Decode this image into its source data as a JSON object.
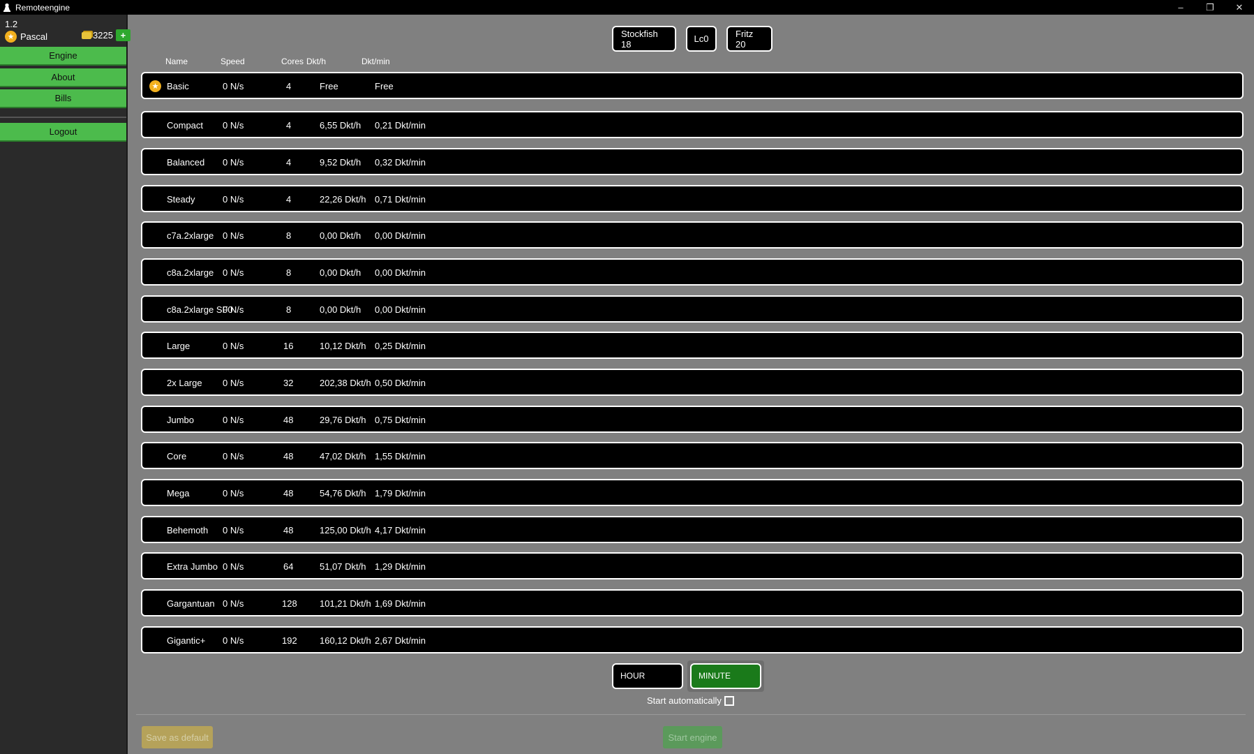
{
  "window": {
    "title": "Remoteengine",
    "controls": [
      "–",
      "❐",
      "✕"
    ]
  },
  "sidebar": {
    "version": "1.2",
    "user": "Pascal",
    "coins": "3225",
    "add_label": "+",
    "nav": [
      {
        "label": "Engine"
      },
      {
        "label": "About"
      },
      {
        "label": "Bills"
      }
    ],
    "logout_label": "Logout"
  },
  "engines": [
    "Stockfish 18",
    "Lc0",
    "Fritz 20"
  ],
  "columns": {
    "name": "Name",
    "speed": "Speed",
    "cores": "Cores",
    "per_hour": "Dkt/h",
    "per_min": "Dkt/min"
  },
  "rows": [
    {
      "name": "Basic",
      "speed": "0 N/s",
      "cores": "4",
      "per_hour": "Free",
      "per_min": "Free",
      "starred": true
    },
    {
      "name": "Compact",
      "speed": "0 N/s",
      "cores": "4",
      "per_hour": "6,55 Dkt/h",
      "per_min": "0,21 Dkt/min"
    },
    {
      "name": "Balanced",
      "speed": "0 N/s",
      "cores": "4",
      "per_hour": "9,52 Dkt/h",
      "per_min": "0,32 Dkt/min"
    },
    {
      "name": "Steady",
      "speed": "0 N/s",
      "cores": "4",
      "per_hour": "22,26 Dkt/h",
      "per_min": "0,71 Dkt/min"
    },
    {
      "name": "c7a.2xlarge",
      "speed": "0 N/s",
      "cores": "8",
      "per_hour": "0,00 Dkt/h",
      "per_min": "0,00 Dkt/min"
    },
    {
      "name": "c8a.2xlarge",
      "speed": "0 N/s",
      "cores": "8",
      "per_hour": "0,00 Dkt/h",
      "per_min": "0,00 Dkt/min"
    },
    {
      "name": "c8a.2xlarge SF0",
      "speed": "0 N/s",
      "cores": "8",
      "per_hour": "0,00 Dkt/h",
      "per_min": "0,00 Dkt/min"
    },
    {
      "name": "Large",
      "speed": "0 N/s",
      "cores": "16",
      "per_hour": "10,12 Dkt/h",
      "per_min": "0,25 Dkt/min"
    },
    {
      "name": "2x Large",
      "speed": "0 N/s",
      "cores": "32",
      "per_hour": "202,38 Dkt/h",
      "per_min": "0,50 Dkt/min"
    },
    {
      "name": "Jumbo",
      "speed": "0 N/s",
      "cores": "48",
      "per_hour": "29,76 Dkt/h",
      "per_min": "0,75 Dkt/min"
    },
    {
      "name": "Core",
      "speed": "0 N/s",
      "cores": "48",
      "per_hour": "47,02 Dkt/h",
      "per_min": "1,55 Dkt/min"
    },
    {
      "name": "Mega",
      "speed": "0 N/s",
      "cores": "48",
      "per_hour": "54,76 Dkt/h",
      "per_min": "1,79 Dkt/min"
    },
    {
      "name": "Behemoth",
      "speed": "0 N/s",
      "cores": "48",
      "per_hour": "125,00 Dkt/h",
      "per_min": "4,17 Dkt/min"
    },
    {
      "name": "Extra Jumbo",
      "speed": "0 N/s",
      "cores": "64",
      "per_hour": "51,07 Dkt/h",
      "per_min": "1,29 Dkt/min"
    },
    {
      "name": "Gargantuan",
      "speed": "0 N/s",
      "cores": "128",
      "per_hour": "101,21 Dkt/h",
      "per_min": "1,69 Dkt/min"
    },
    {
      "name": "Gigantic+",
      "speed": "0 N/s",
      "cores": "192",
      "per_hour": "160,12 Dkt/h",
      "per_min": "2,67 Dkt/min"
    }
  ],
  "units": {
    "hour": "HOUR",
    "minute": "MINUTE",
    "selected": "MINUTE"
  },
  "autostart_label": "Start automatically",
  "save_default_label": "Save as default",
  "start_engine_label": "Start engine",
  "colors": {
    "accent_green": "#4cbb4c",
    "selected_green": "#1a7a1a",
    "star_gold": "#f2b01e",
    "background": "#808080",
    "sidebar": "#2a2a2a"
  }
}
